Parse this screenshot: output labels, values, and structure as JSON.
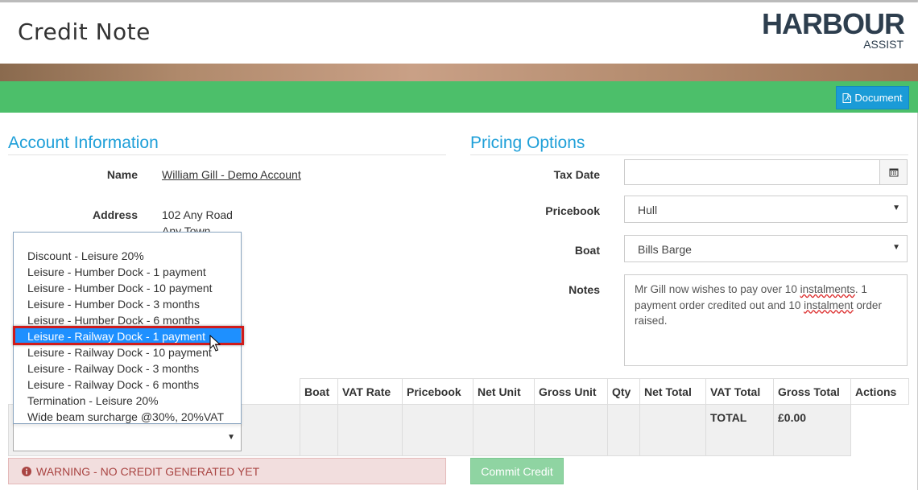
{
  "header": {
    "title": "Credit Note",
    "logo_main": "HARBOUR",
    "logo_sub": "ASSIST",
    "document_label": "Document"
  },
  "account": {
    "section_title": "Account Information",
    "name_label": "Name",
    "name_value": "William Gill - Demo Account",
    "address_label": "Address",
    "address_line1": "102 Any Road",
    "address_line2": "Any Town"
  },
  "pricing": {
    "section_title": "Pricing Options",
    "tax_date_label": "Tax Date",
    "tax_date_value": "",
    "pricebook_label": "Pricebook",
    "pricebook_value": "Hull",
    "boat_label": "Boat",
    "boat_value": "Bills Barge",
    "notes_label": "Notes",
    "notes_part1": "Mr Gill now wishes to pay over 10 ",
    "notes_sq1": "instalments",
    "notes_part2": ".  1 payment order credited out and 10 ",
    "notes_sq2": "instalment",
    "notes_part3": " order raised."
  },
  "dropdown": {
    "items": [
      "Discount - Leisure 20%",
      "Leisure - Humber Dock - 1 payment",
      "Leisure - Humber Dock - 10 payment",
      "Leisure - Humber Dock - 3 months",
      "Leisure - Humber Dock - 6 months",
      "Leisure - Railway Dock - 1 payment",
      "Leisure - Railway Dock - 10 payment",
      "Leisure - Railway Dock - 3 months",
      "Leisure - Railway Dock - 6 months",
      "Termination - Leisure 20%",
      "Wide beam surcharge @30%, 20%VAT"
    ],
    "selected_index": 5
  },
  "table": {
    "columns": [
      "Boat",
      "VAT Rate",
      "Pricebook",
      "Net Unit",
      "Gross Unit",
      "Qty",
      "Net Total",
      "VAT Total",
      "Gross Total",
      "Actions"
    ],
    "total_label": "TOTAL",
    "total_value": "£0.00"
  },
  "footer": {
    "warning": "WARNING - NO CREDIT GENERATED YET",
    "commit_label": "Commit Credit"
  },
  "colors": {
    "accent": "#1e9fd8",
    "green_bar": "#4cbf6a",
    "selection": "#1e90ff",
    "highlight_border": "#d01b1b"
  }
}
